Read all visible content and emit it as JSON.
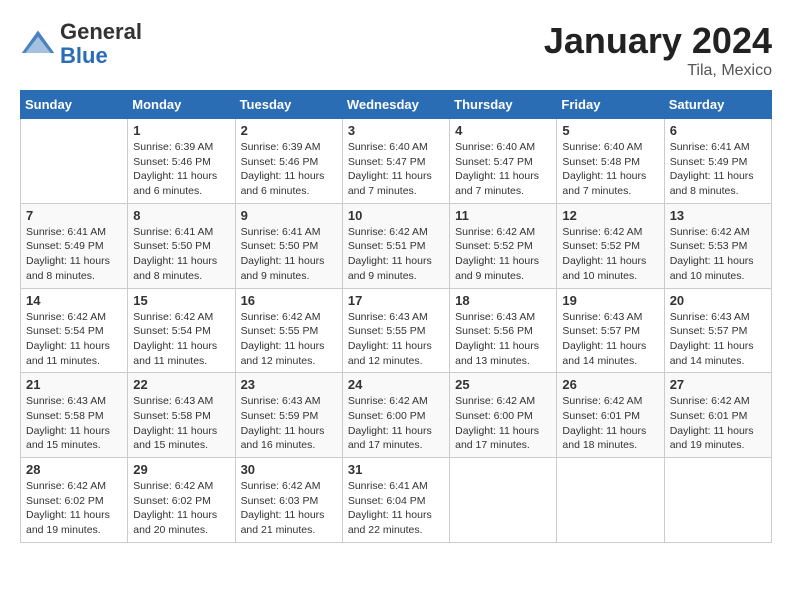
{
  "header": {
    "logo_general": "General",
    "logo_blue": "Blue",
    "month_title": "January 2024",
    "location": "Tila, Mexico"
  },
  "columns": [
    "Sunday",
    "Monday",
    "Tuesday",
    "Wednesday",
    "Thursday",
    "Friday",
    "Saturday"
  ],
  "weeks": [
    [
      {
        "day": "",
        "sunrise": "",
        "sunset": "",
        "daylight": ""
      },
      {
        "day": "1",
        "sunrise": "Sunrise: 6:39 AM",
        "sunset": "Sunset: 5:46 PM",
        "daylight": "Daylight: 11 hours and 6 minutes."
      },
      {
        "day": "2",
        "sunrise": "Sunrise: 6:39 AM",
        "sunset": "Sunset: 5:46 PM",
        "daylight": "Daylight: 11 hours and 6 minutes."
      },
      {
        "day": "3",
        "sunrise": "Sunrise: 6:40 AM",
        "sunset": "Sunset: 5:47 PM",
        "daylight": "Daylight: 11 hours and 7 minutes."
      },
      {
        "day": "4",
        "sunrise": "Sunrise: 6:40 AM",
        "sunset": "Sunset: 5:47 PM",
        "daylight": "Daylight: 11 hours and 7 minutes."
      },
      {
        "day": "5",
        "sunrise": "Sunrise: 6:40 AM",
        "sunset": "Sunset: 5:48 PM",
        "daylight": "Daylight: 11 hours and 7 minutes."
      },
      {
        "day": "6",
        "sunrise": "Sunrise: 6:41 AM",
        "sunset": "Sunset: 5:49 PM",
        "daylight": "Daylight: 11 hours and 8 minutes."
      }
    ],
    [
      {
        "day": "7",
        "sunrise": "Sunrise: 6:41 AM",
        "sunset": "Sunset: 5:49 PM",
        "daylight": "Daylight: 11 hours and 8 minutes."
      },
      {
        "day": "8",
        "sunrise": "Sunrise: 6:41 AM",
        "sunset": "Sunset: 5:50 PM",
        "daylight": "Daylight: 11 hours and 8 minutes."
      },
      {
        "day": "9",
        "sunrise": "Sunrise: 6:41 AM",
        "sunset": "Sunset: 5:50 PM",
        "daylight": "Daylight: 11 hours and 9 minutes."
      },
      {
        "day": "10",
        "sunrise": "Sunrise: 6:42 AM",
        "sunset": "Sunset: 5:51 PM",
        "daylight": "Daylight: 11 hours and 9 minutes."
      },
      {
        "day": "11",
        "sunrise": "Sunrise: 6:42 AM",
        "sunset": "Sunset: 5:52 PM",
        "daylight": "Daylight: 11 hours and 9 minutes."
      },
      {
        "day": "12",
        "sunrise": "Sunrise: 6:42 AM",
        "sunset": "Sunset: 5:52 PM",
        "daylight": "Daylight: 11 hours and 10 minutes."
      },
      {
        "day": "13",
        "sunrise": "Sunrise: 6:42 AM",
        "sunset": "Sunset: 5:53 PM",
        "daylight": "Daylight: 11 hours and 10 minutes."
      }
    ],
    [
      {
        "day": "14",
        "sunrise": "Sunrise: 6:42 AM",
        "sunset": "Sunset: 5:54 PM",
        "daylight": "Daylight: 11 hours and 11 minutes."
      },
      {
        "day": "15",
        "sunrise": "Sunrise: 6:42 AM",
        "sunset": "Sunset: 5:54 PM",
        "daylight": "Daylight: 11 hours and 11 minutes."
      },
      {
        "day": "16",
        "sunrise": "Sunrise: 6:42 AM",
        "sunset": "Sunset: 5:55 PM",
        "daylight": "Daylight: 11 hours and 12 minutes."
      },
      {
        "day": "17",
        "sunrise": "Sunrise: 6:43 AM",
        "sunset": "Sunset: 5:55 PM",
        "daylight": "Daylight: 11 hours and 12 minutes."
      },
      {
        "day": "18",
        "sunrise": "Sunrise: 6:43 AM",
        "sunset": "Sunset: 5:56 PM",
        "daylight": "Daylight: 11 hours and 13 minutes."
      },
      {
        "day": "19",
        "sunrise": "Sunrise: 6:43 AM",
        "sunset": "Sunset: 5:57 PM",
        "daylight": "Daylight: 11 hours and 14 minutes."
      },
      {
        "day": "20",
        "sunrise": "Sunrise: 6:43 AM",
        "sunset": "Sunset: 5:57 PM",
        "daylight": "Daylight: 11 hours and 14 minutes."
      }
    ],
    [
      {
        "day": "21",
        "sunrise": "Sunrise: 6:43 AM",
        "sunset": "Sunset: 5:58 PM",
        "daylight": "Daylight: 11 hours and 15 minutes."
      },
      {
        "day": "22",
        "sunrise": "Sunrise: 6:43 AM",
        "sunset": "Sunset: 5:58 PM",
        "daylight": "Daylight: 11 hours and 15 minutes."
      },
      {
        "day": "23",
        "sunrise": "Sunrise: 6:43 AM",
        "sunset": "Sunset: 5:59 PM",
        "daylight": "Daylight: 11 hours and 16 minutes."
      },
      {
        "day": "24",
        "sunrise": "Sunrise: 6:42 AM",
        "sunset": "Sunset: 6:00 PM",
        "daylight": "Daylight: 11 hours and 17 minutes."
      },
      {
        "day": "25",
        "sunrise": "Sunrise: 6:42 AM",
        "sunset": "Sunset: 6:00 PM",
        "daylight": "Daylight: 11 hours and 17 minutes."
      },
      {
        "day": "26",
        "sunrise": "Sunrise: 6:42 AM",
        "sunset": "Sunset: 6:01 PM",
        "daylight": "Daylight: 11 hours and 18 minutes."
      },
      {
        "day": "27",
        "sunrise": "Sunrise: 6:42 AM",
        "sunset": "Sunset: 6:01 PM",
        "daylight": "Daylight: 11 hours and 19 minutes."
      }
    ],
    [
      {
        "day": "28",
        "sunrise": "Sunrise: 6:42 AM",
        "sunset": "Sunset: 6:02 PM",
        "daylight": "Daylight: 11 hours and 19 minutes."
      },
      {
        "day": "29",
        "sunrise": "Sunrise: 6:42 AM",
        "sunset": "Sunset: 6:02 PM",
        "daylight": "Daylight: 11 hours and 20 minutes."
      },
      {
        "day": "30",
        "sunrise": "Sunrise: 6:42 AM",
        "sunset": "Sunset: 6:03 PM",
        "daylight": "Daylight: 11 hours and 21 minutes."
      },
      {
        "day": "31",
        "sunrise": "Sunrise: 6:41 AM",
        "sunset": "Sunset: 6:04 PM",
        "daylight": "Daylight: 11 hours and 22 minutes."
      },
      {
        "day": "",
        "sunrise": "",
        "sunset": "",
        "daylight": ""
      },
      {
        "day": "",
        "sunrise": "",
        "sunset": "",
        "daylight": ""
      },
      {
        "day": "",
        "sunrise": "",
        "sunset": "",
        "daylight": ""
      }
    ]
  ]
}
